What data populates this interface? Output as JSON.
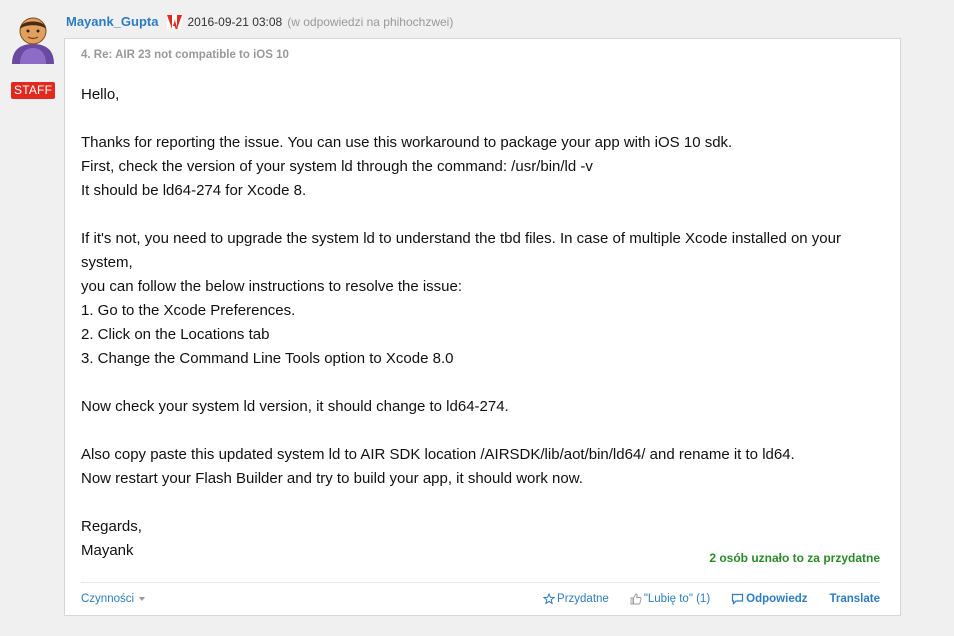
{
  "post": {
    "author": "Mayank_Gupta",
    "badge": "STAFF",
    "date": "2016-09-21 03:08",
    "reply_to": "(w odpowiedzi na phihochzwei)",
    "subject": "4. Re: AIR 23 not compatible to iOS 10",
    "body": {
      "greeting": "Hello,",
      "p1": [
        "Thanks for reporting the issue. You can use this workaround to package your app with iOS 10 sdk.",
        "First, check the version of your system ld through the command: /usr/bin/ld -v",
        "It should be ld64-274 for Xcode 8."
      ],
      "p2": [
        "If it's not, you need to upgrade the system ld to understand the tbd files. In case of multiple Xcode installed on your system,",
        "you can follow the below instructions to resolve the issue:",
        "1. Go to the Xcode Preferences.",
        "2. Click on the Locations tab",
        "3. Change the Command Line Tools option to Xcode 8.0"
      ],
      "p3": "Now check your system ld version, it should change to ld64-274.",
      "p4": [
        "Also copy paste this updated system ld to AIR SDK location /AIRSDK/lib/aot/bin/ld64/ and rename it to ld64.",
        "Now restart your Flash Builder and try to build your app, it should work now."
      ],
      "signoff": [
        "Regards,",
        "Mayank"
      ]
    },
    "helpful_count": "2 osób uznało to za przydatne"
  },
  "footer": {
    "actions_label": "Czynności",
    "helpful_label": "Przydatne",
    "like_label": "\"Lubię to\" (1)",
    "reply_label": "Odpowiedz",
    "translate_label": "Translate"
  },
  "colors": {
    "link": "#2d7cc1",
    "staff_badge": "#e02a20",
    "helpful_text": "#2a8a2a"
  }
}
